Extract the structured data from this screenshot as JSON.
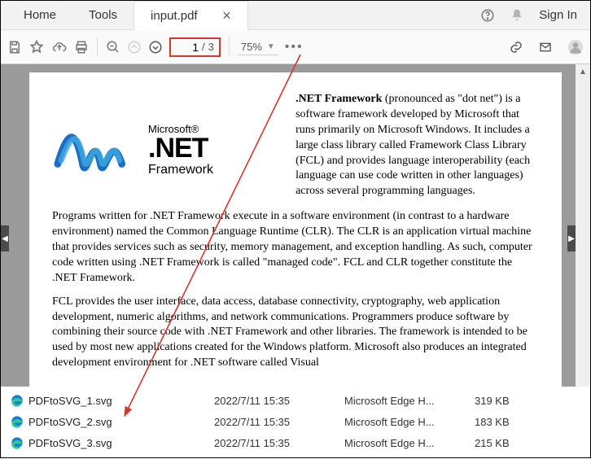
{
  "tabs": {
    "home": "Home",
    "tools": "Tools",
    "file": "input.pdf"
  },
  "signin": "Sign In",
  "page": {
    "current": "1",
    "sep": "/",
    "total": "3"
  },
  "zoom": "75%",
  "doc": {
    "logo": {
      "brand": "Microsoft",
      "reg": "®",
      "big": ".NET",
      "fw": "Framework"
    },
    "introHead": ".NET Framework",
    "intro": " (pronounced as \"dot net\") is a software framework developed by Microsoft that runs primarily on Microsoft Windows. It includes a large class library called Framework Class Library (FCL) and provides language interoperability (each language can use code written in other languages) across several programming languages.",
    "p2": "Programs written for .NET Framework execute in a software environment (in contrast to a hardware environment) named the Common Language Runtime (CLR). The CLR is an application virtual machine that provides services such as security, memory management, and exception handling. As such, computer code written using .NET Framework is called \"managed code\". FCL and CLR together constitute the .NET Framework.",
    "p3": "FCL provides the user interface, data access, database connectivity, cryptography, web application development, numeric algorithms, and network communications. Programmers produce software by combining their source code with .NET Framework and other libraries. The framework is intended to be used by most new applications created for the Windows platform. Microsoft also produces an integrated development environment for .NET software called Visual"
  },
  "files": [
    {
      "name": "PDFtoSVG_1.svg",
      "date": "2022/7/11 15:35",
      "app": "Microsoft Edge H...",
      "size": "319 KB"
    },
    {
      "name": "PDFtoSVG_2.svg",
      "date": "2022/7/11 15:35",
      "app": "Microsoft Edge H...",
      "size": "183 KB"
    },
    {
      "name": "PDFtoSVG_3.svg",
      "date": "2022/7/11 15:35",
      "app": "Microsoft Edge H...",
      "size": "215 KB"
    }
  ]
}
